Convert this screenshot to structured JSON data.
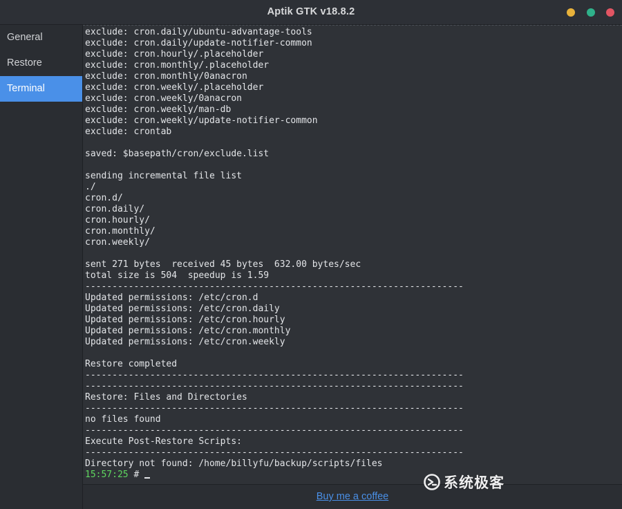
{
  "window": {
    "title": "Aptik GTK v18.8.2",
    "buttons": [
      {
        "name": "minimize",
        "color": "#e8b23b"
      },
      {
        "name": "maximize",
        "color": "#2fb18a"
      },
      {
        "name": "close",
        "color": "#e25563"
      }
    ]
  },
  "sidebar": {
    "items": [
      {
        "label": "General",
        "active": false
      },
      {
        "label": "Restore",
        "active": false
      },
      {
        "label": "Terminal",
        "active": true
      }
    ],
    "accent": "#4a90e8"
  },
  "terminal": {
    "lines": [
      "exclude: cron.daily/ubuntu-advantage-tools",
      "exclude: cron.daily/update-notifier-common",
      "exclude: cron.hourly/.placeholder",
      "exclude: cron.monthly/.placeholder",
      "exclude: cron.monthly/0anacron",
      "exclude: cron.weekly/.placeholder",
      "exclude: cron.weekly/0anacron",
      "exclude: cron.weekly/man-db",
      "exclude: cron.weekly/update-notifier-common",
      "exclude: crontab",
      "",
      "saved: $basepath/cron/exclude.list",
      "",
      "sending incremental file list",
      "./",
      "cron.d/",
      "cron.daily/",
      "cron.hourly/",
      "cron.monthly/",
      "cron.weekly/",
      "",
      "sent 271 bytes  received 45 bytes  632.00 bytes/sec",
      "total size is 504  speedup is 1.59",
      "----------------------------------------------------------------------",
      "Updated permissions: /etc/cron.d",
      "Updated permissions: /etc/cron.daily",
      "Updated permissions: /etc/cron.hourly",
      "Updated permissions: /etc/cron.monthly",
      "Updated permissions: /etc/cron.weekly",
      "",
      "Restore completed",
      "----------------------------------------------------------------------",
      "----------------------------------------------------------------------",
      "Restore: Files and Directories",
      "----------------------------------------------------------------------",
      "no files found",
      "----------------------------------------------------------------------",
      "Execute Post-Restore Scripts:",
      "----------------------------------------------------------------------",
      "Directory not found: /home/billyfu/backup/scripts/files"
    ],
    "prompt": {
      "time": "15:57:25",
      "symbol": " # "
    }
  },
  "footer": {
    "link_label": "Buy me a coffee"
  },
  "watermark": {
    "text": "系统极客"
  }
}
